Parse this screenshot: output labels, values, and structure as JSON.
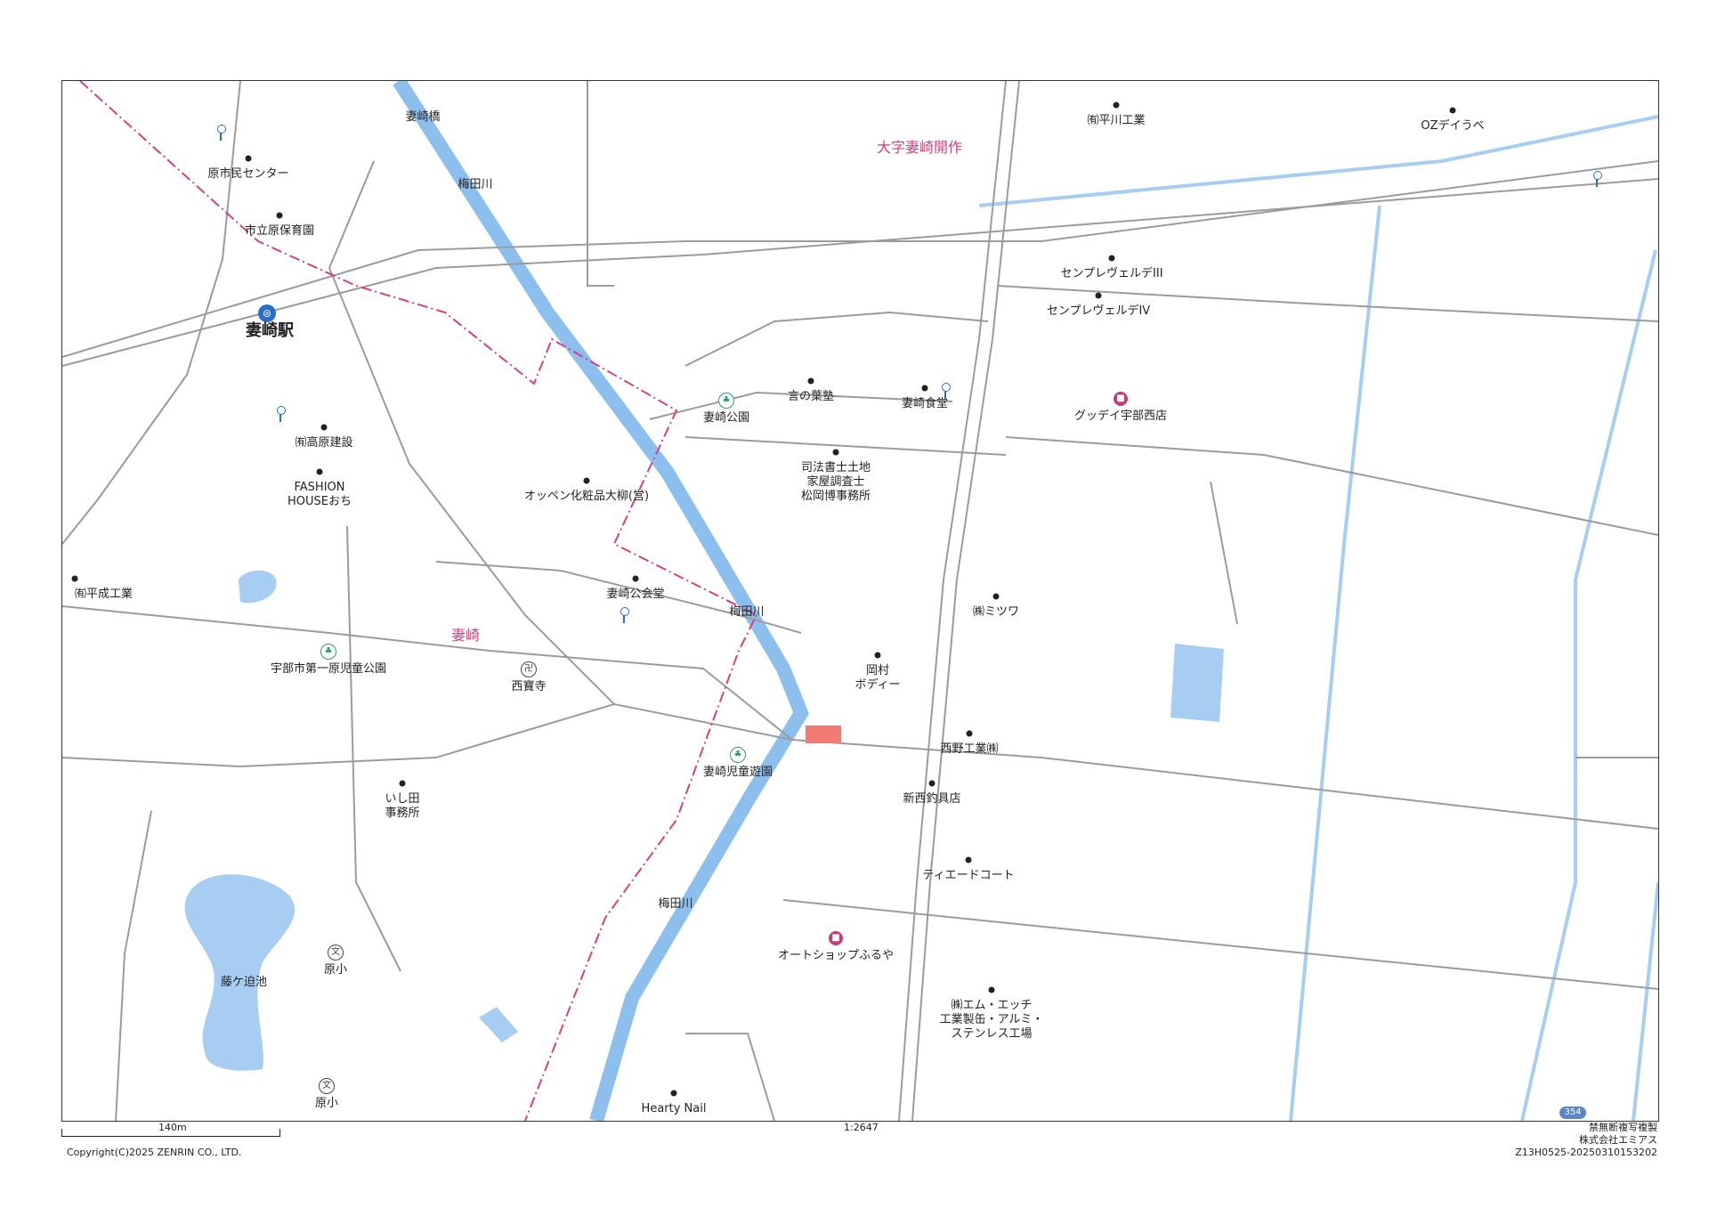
{
  "colors": {
    "road": "#9b9b9b",
    "water": "#a8cdf3",
    "river": "#8dbfee",
    "boundary": "#d6407f",
    "building": "#ececec",
    "facility": "#f8f4d8",
    "highlight": "#f27a74"
  },
  "area_labels": [
    "大字妻崎開作",
    "妻崎"
  ],
  "station": {
    "name": "妻崎駅",
    "icon": "train-station-icon"
  },
  "labels": [
    "妻崎橋",
    "梅田川",
    "原市民センター",
    "市立原保育園",
    "㈲平川工業",
    "OZデイうべ",
    "センプレヴェルデIII",
    "センプレヴェルデIV",
    "グッデイ宇部西店",
    "妻崎公園",
    "言の葉塾",
    "妻崎食堂",
    "㈲高原建設",
    "FASHION\nHOUSEおち",
    "オッペン化粧品大柳(営)",
    "司法書士土地\n家屋調査士\n松岡博事務所",
    "㈲平成工業",
    "妻崎公会堂",
    "梅田川",
    "㈱ミツワ",
    "宇部市第一原児童公園",
    "西寶寺",
    "岡村\nボディー",
    "西野工業㈱",
    "妻崎児童遊園",
    "いし田\n事務所",
    "新西釣具店",
    "ティエードコート",
    "梅田川",
    "オートショップふるや",
    "藤ケ迫池",
    "原小",
    "㈱エム・エッチ\n工業製缶・アルミ・\nステンレス工場",
    "原小",
    "Hearty Nail"
  ],
  "route_badge": "354",
  "scale": {
    "distance": "140m",
    "ratio": "1:2647"
  },
  "footer": {
    "copyright": "Copyright(C)2025 ZENRIN CO., LTD.",
    "notice": "禁無断複写複製",
    "company": "株式会社エミアス",
    "code": "Z13H0525-20250310153202"
  }
}
